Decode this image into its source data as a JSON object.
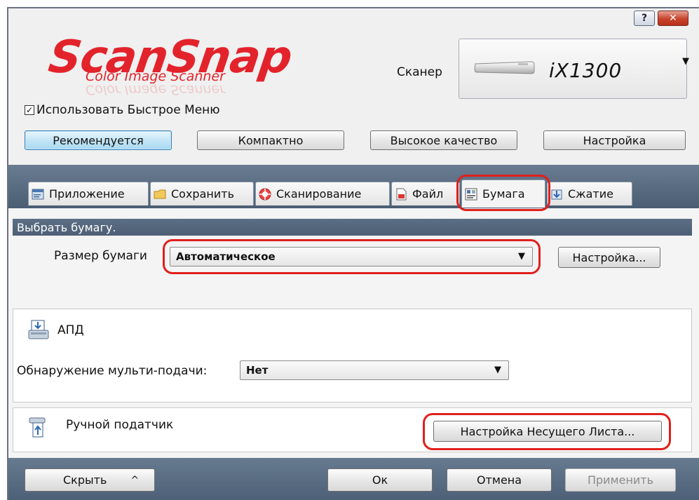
{
  "window": {
    "help_glyph": "?",
    "close_glyph": "✕"
  },
  "logo": {
    "main": "ScanSnap",
    "sub": "Color Image Scanner"
  },
  "scanner": {
    "label": "Сканер",
    "model": "iX1300"
  },
  "quick_menu": {
    "label": "Использовать Быстрое Меню",
    "checked": true
  },
  "presets": [
    {
      "label": "Рекомендуется",
      "active": true
    },
    {
      "label": "Компактно",
      "active": false
    },
    {
      "label": "Высокое качество",
      "active": false
    },
    {
      "label": "Настройка",
      "active": false
    }
  ],
  "tabs": [
    {
      "label": "Приложение",
      "icon": "app-window-icon"
    },
    {
      "label": "Сохранить",
      "icon": "folder-icon"
    },
    {
      "label": "Сканирование",
      "icon": "scan-disc-icon"
    },
    {
      "label": "Файл",
      "icon": "file-icon"
    },
    {
      "label": "Бумага",
      "icon": "paper-icon",
      "active": true
    },
    {
      "label": "Сжатие",
      "icon": "compress-icon"
    }
  ],
  "paper": {
    "section_title": "Выбрать бумагу.",
    "size_label": "Размер бумаги",
    "size_value": "Автоматическое",
    "settings_button": "Настройка..."
  },
  "adf": {
    "title": "АПД",
    "multifeed_label": "Обнаружение мульти-подачи:",
    "multifeed_value": "Нет"
  },
  "manual_feeder": {
    "title": "Ручной податчик",
    "carrier_button": "Настройка Несущего Листа..."
  },
  "footer": {
    "hide_button": "Скрыть",
    "hide_caret": "^",
    "ok_button": "Ок",
    "cancel_button": "Отмена",
    "apply_button": "Применить"
  },
  "colors": {
    "brand_red": "#e3232b",
    "band": "#4e6178",
    "highlight": "#e0201c"
  }
}
